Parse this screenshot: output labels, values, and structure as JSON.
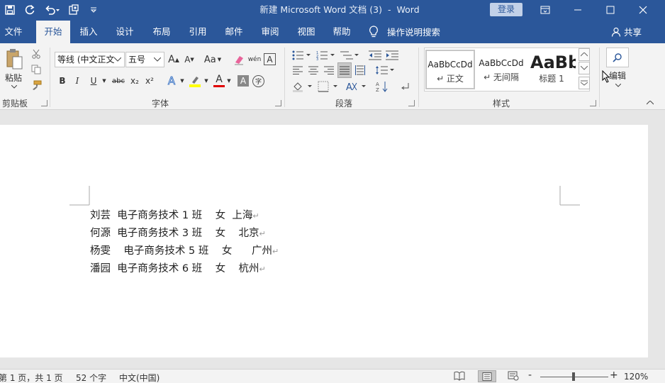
{
  "titlebar": {
    "title": "新建 Microsoft Word 文档 (3)",
    "separator": "-",
    "app": "Word",
    "login": "登录"
  },
  "tabs": [
    "文件",
    "开始",
    "插入",
    "设计",
    "布局",
    "引用",
    "邮件",
    "审阅",
    "视图",
    "帮助"
  ],
  "active_tab": "开始",
  "tellme": "操作说明搜索",
  "share": "共享",
  "ribbon": {
    "clipboard": {
      "paste": "粘贴",
      "label": "剪贴板"
    },
    "font": {
      "font_name": "等线 (中文正文",
      "font_size": "五号",
      "label": "字体",
      "grow": "A",
      "shrink": "A",
      "change_case": "Aa",
      "bold": "B",
      "italic": "I",
      "underline": "U",
      "strike": "abc",
      "subscript": "x₂",
      "superscript": "x²",
      "effects": "A",
      "font_color": "A",
      "char_shade": "A",
      "enclose": "字",
      "phonetic": "wén",
      "border_char": "A"
    },
    "paragraph": {
      "label": "段落"
    },
    "styles": {
      "label": "样式",
      "items": [
        {
          "sample": "AaBbCcDd",
          "name": "↵ 正文"
        },
        {
          "sample": "AaBbCcDd",
          "name": "↵ 无间隔"
        },
        {
          "sample": "AaBb",
          "name": "标题 1"
        }
      ]
    },
    "editing": {
      "label": "编辑"
    }
  },
  "document": {
    "lines": [
      "刘芸  电子商务技术 1 班    女  上海",
      "何源  电子商务技术 3 班    女    北京",
      "杨雯    电子商务技术 5 班    女      广州",
      "潘园  电子商务技术 6 班    女    杭州"
    ],
    "para_mark": "↵"
  },
  "status": {
    "page": "第 1 页，共 1 页",
    "words": "52 个字",
    "language": "中文(中国)",
    "zoom": "120%",
    "zoom_minus": "-",
    "zoom_plus": "+"
  },
  "colors": {
    "brand": "#2b579a",
    "highlight": "#ffff00",
    "font_color": "#e00000"
  }
}
